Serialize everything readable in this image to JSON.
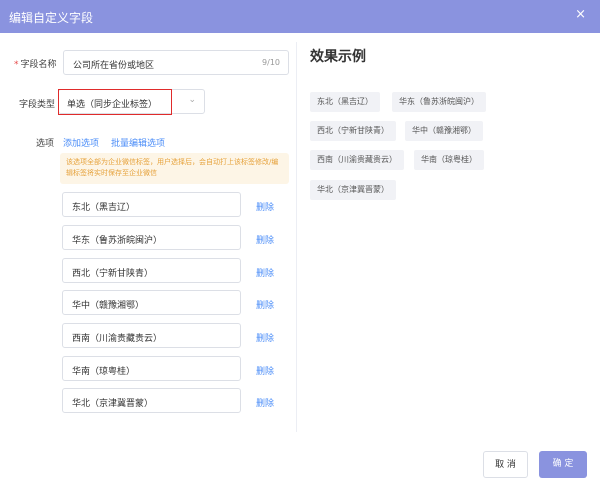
{
  "dialog": {
    "title": "编辑自定义字段",
    "close_glyph": "×"
  },
  "form": {
    "name_label": "字段名称",
    "name_value": "公司所在省份或地区",
    "name_count": "9/10",
    "type_label": "字段类型",
    "type_value": "单选（同步企业标签）",
    "options_label": "选项",
    "add_option": "添加选项",
    "batch_edit": "批量编辑选项",
    "notice": "该选项全部为企业微信标签，用户选择后，会自动打上该标签修改/编辑标签将实时保存至企业微信",
    "delete_label": "删除",
    "options": [
      "东北（黑吉辽）",
      "华东（鲁苏浙皖闽沪）",
      "西北（宁新甘陕青）",
      "华中（赣豫湘鄂）",
      "西南（川渝贵藏贵云）",
      "华南（琼粤桂）",
      "华北（京津冀晋蒙）"
    ]
  },
  "preview": {
    "title": "效果示例",
    "tags": [
      "东北（黑吉辽）",
      "华东（鲁苏浙皖闽沪）",
      "西北（宁新甘陕青）",
      "华中（赣豫湘鄂）",
      "西南（川渝贵藏贵云）",
      "华南（琼粤桂）",
      "华北（京津冀晋蒙）"
    ]
  },
  "footer": {
    "cancel": "取 消",
    "confirm": "确 定"
  },
  "colors": {
    "header": "#8a93df",
    "link": "#4b8df8",
    "notice_text": "#e6a23c",
    "notice_bg": "#fdf5e6",
    "highlight": "#e02b2b"
  }
}
